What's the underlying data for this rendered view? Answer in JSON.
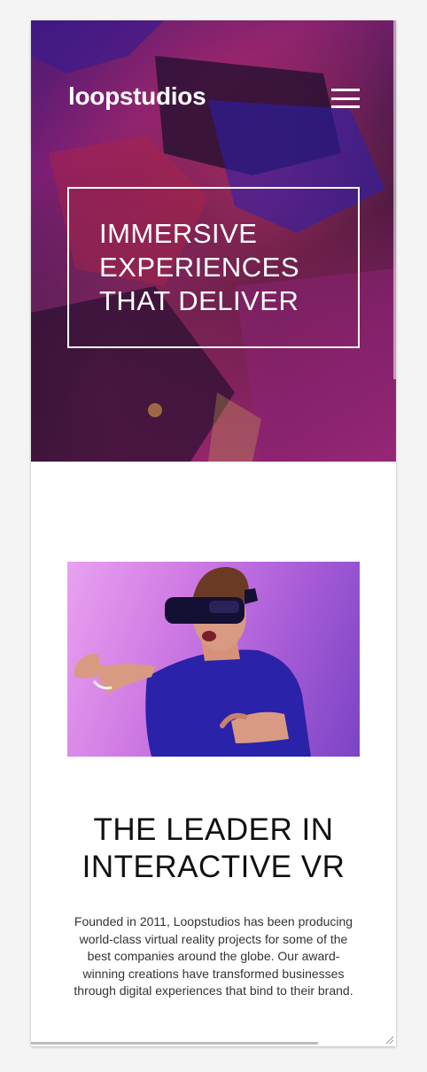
{
  "header": {
    "logo": "loopstudios",
    "menu_icon": "hamburger-menu-icon"
  },
  "hero": {
    "title": "IMMERSIVE\nEXPERIENCES\nTHAT DELIVER"
  },
  "about": {
    "title": "THE LEADER IN\nINTERACTIVE VR",
    "text": "Founded in 2011, Loopstudios has been producing world-class virtual reality projects for some of the best companies around the globe. Our award-winning creations have transformed businesses through digital experiences that bind to their brand."
  },
  "colors": {
    "hero_overlay": "#6b2070",
    "text_dark": "#111111",
    "white": "#ffffff"
  }
}
